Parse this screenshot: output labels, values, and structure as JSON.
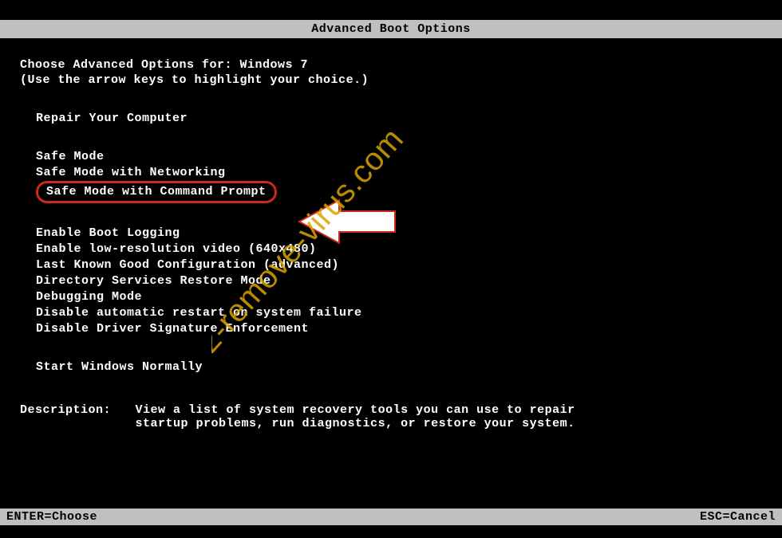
{
  "title": "Advanced Boot Options",
  "prompt": "Choose Advanced Options for: ",
  "os_name": "Windows 7",
  "hint": "(Use the arrow keys to highlight your choice.)",
  "groups": {
    "repair": [
      "Repair Your Computer"
    ],
    "safe": [
      "Safe Mode",
      "Safe Mode with Networking",
      "Safe Mode with Command Prompt"
    ],
    "advanced": [
      "Enable Boot Logging",
      "Enable low-resolution video (640x480)",
      "Last Known Good Configuration (advanced)",
      "Directory Services Restore Mode",
      "Debugging Mode",
      "Disable automatic restart on system failure",
      "Disable Driver Signature Enforcement"
    ],
    "normal": [
      "Start Windows Normally"
    ]
  },
  "highlighted_item": "Safe Mode with Command Prompt",
  "description": {
    "label": "Description:",
    "text": "View a list of system recovery tools you can use to repair startup problems, run diagnostics, or restore your system."
  },
  "footer": {
    "enter": "ENTER=Choose",
    "esc": "ESC=Cancel"
  },
  "watermark": "2-remove-virus.com",
  "arrow_color": "#ffffff",
  "arrow_stroke": "#cc2a1a",
  "watermark_color": "#d9a400"
}
